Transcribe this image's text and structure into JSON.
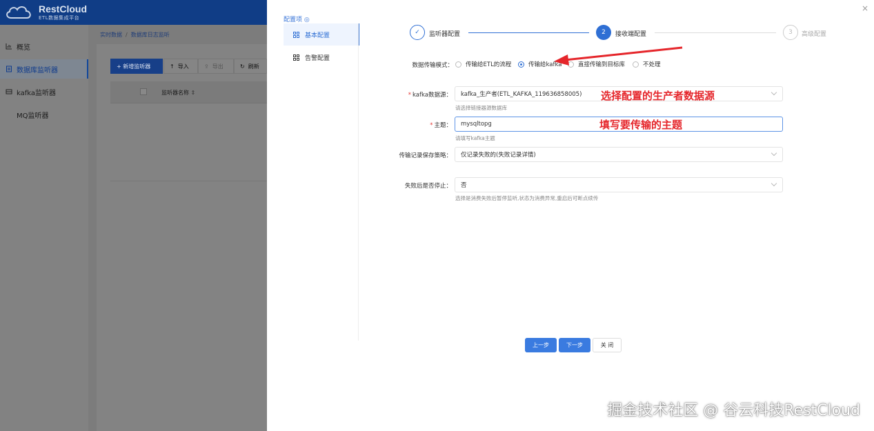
{
  "app": {
    "logo_title": "RestCloud",
    "logo_subtitle": "ETL数据集成平台"
  },
  "sidebar": {
    "items": [
      {
        "label": "概览",
        "icon": "chart-icon"
      },
      {
        "label": "数据库监听器",
        "icon": "list-icon",
        "active": true
      },
      {
        "label": "kafka监听器",
        "icon": "kafka-icon"
      },
      {
        "label": "MQ监听器",
        "icon": "mq-icon"
      }
    ]
  },
  "breadcrumb": {
    "items": [
      "实时数据",
      "数据库日志监听"
    ]
  },
  "toolbar": {
    "new_label": "+ 新增监听器",
    "import_label": "导入",
    "export_label": "导出",
    "refresh_label": "刷新"
  },
  "grid": {
    "column_name": "监听器名称"
  },
  "drawer": {
    "config_heading": "配置项",
    "menu": [
      {
        "label": "基本配置",
        "active": true
      },
      {
        "label": "告警配置",
        "active": false
      }
    ],
    "steps": [
      {
        "number": "✓",
        "label": "监听器配置",
        "status": "done"
      },
      {
        "number": "2",
        "label": "接收端配置",
        "status": "active"
      },
      {
        "number": "3",
        "label": "高级配置",
        "status": "pending"
      }
    ],
    "form": {
      "mode_label": "数据传输模式：",
      "mode_options": [
        {
          "label": "传输给ETL的流程",
          "selected": false
        },
        {
          "label": "传输给kafka",
          "selected": true
        },
        {
          "label": "直接传输到目标库",
          "selected": false
        },
        {
          "label": "不处理",
          "selected": false
        }
      ],
      "kafka_source_label": "kafka数据源：",
      "kafka_source_value": "kafka_生产者(ETL_KAFKA_119636858005)",
      "kafka_source_hint": "请选择链接器源数据库",
      "topic_label": "主题：",
      "topic_value": "mysqltopg",
      "topic_hint": "请填写kafka主题",
      "policy_label": "传输记录保存策略：",
      "policy_value": "仅记录失败的(失败记录详情)",
      "stop_label": "失败后是否停止：",
      "stop_value": "否",
      "stop_hint": "选择是消费失败后暂停监听,状态为消费异常,重启后可断点续传"
    },
    "annotations": {
      "source_note": "选择配置的生产者数据源",
      "topic_note": "填写要传输的主题"
    },
    "buttons": {
      "prev": "上一步",
      "next": "下一步",
      "close": "关 闭"
    },
    "close_x": "×"
  },
  "watermark": "掘金技术社区 @ 谷云科技RestCloud",
  "colors": {
    "primary": "#3a7be0",
    "annotation": "#e5262b",
    "topbar": "#103d86"
  }
}
